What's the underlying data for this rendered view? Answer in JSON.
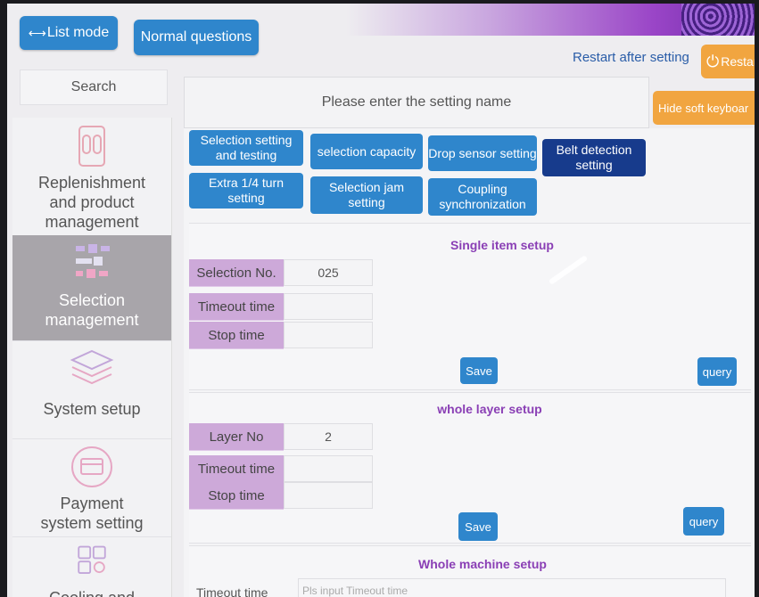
{
  "toolbar": {
    "list_mode": "List mode",
    "normal_questions": "Normal questions",
    "restart_label": "Restart after setting",
    "restart_button": "Restar"
  },
  "search": {
    "tab_label": "Search",
    "placeholder": "Please enter the setting name",
    "hide_keyboard": "Hide soft keyboar"
  },
  "sidebar": {
    "items": [
      {
        "label": "Replenishment and product management",
        "icon": "vending-machine-icon",
        "active": false
      },
      {
        "label": "Selection management",
        "icon": "selection-grid-icon",
        "active": true
      },
      {
        "label": "System setup",
        "icon": "layers-icon",
        "active": false
      },
      {
        "label": "Payment system setting",
        "icon": "card-icon",
        "active": false
      },
      {
        "label": "Cooling and",
        "icon": "grid-gear-icon",
        "active": false
      }
    ]
  },
  "tabs": [
    {
      "label": "Selection setting and testing",
      "active": false
    },
    {
      "label": "selection capacity",
      "active": false
    },
    {
      "label": "Drop sensor setting",
      "active": false
    },
    {
      "label": "Belt detection setting",
      "active": true
    },
    {
      "label": "Extra 1/4 turn setting",
      "active": false
    },
    {
      "label": "Selection jam setting",
      "active": false
    },
    {
      "label": "Coupling synchronization",
      "active": false
    }
  ],
  "single_item": {
    "title": "Single item setup",
    "rows": [
      {
        "label": "Selection No.",
        "value": "025"
      },
      {
        "label": "Timeout time",
        "value": ""
      },
      {
        "label": "Stop time",
        "value": ""
      }
    ],
    "save": "Save",
    "query": "query"
  },
  "whole_layer": {
    "title": "whole layer setup",
    "rows": [
      {
        "label": "Layer No",
        "value": "2"
      },
      {
        "label": "Timeout time",
        "value": ""
      },
      {
        "label": "Stop time",
        "value": ""
      }
    ],
    "save": "Save",
    "query": "query"
  },
  "whole_machine": {
    "title": "Whole machine setup",
    "timeout_label": "Timeout time",
    "timeout_placeholder": "Pls input Timeout time"
  },
  "colors": {
    "primary_blue": "#2f86cc",
    "active_tab": "#173b8c",
    "accent_orange": "#f1a540",
    "label_purple": "#cda9d9",
    "title_purple": "#8a3fb5"
  }
}
